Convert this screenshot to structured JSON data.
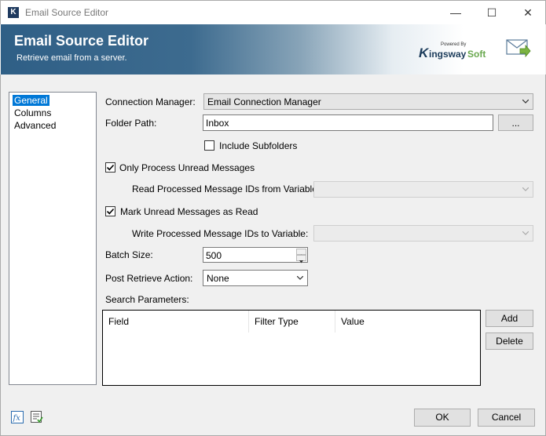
{
  "window": {
    "title": "Email Source Editor",
    "min_glyph": "—",
    "max_glyph": "☐",
    "close_glyph": "✕",
    "app_icon_letter": "K"
  },
  "banner": {
    "title": "Email Source Editor",
    "subtitle": "Retrieve email from a server.",
    "logo": {
      "powered": "Powered By",
      "k": "K",
      "ingsway": "ingsway",
      "soft": "Soft"
    }
  },
  "nav": {
    "items": [
      "General",
      "Columns",
      "Advanced"
    ],
    "selected": "General"
  },
  "form": {
    "connection_manager_label": "Connection Manager:",
    "connection_manager_value": "Email Connection Manager",
    "folder_path_label": "Folder Path:",
    "folder_path_value": "Inbox",
    "browse_label": "...",
    "include_subfolders_label": "Include Subfolders",
    "include_subfolders_checked": false,
    "only_unread_label": "Only Process Unread Messages",
    "only_unread_checked": true,
    "read_ids_var_label": "Read Processed Message IDs from Variable:",
    "read_ids_var_value": "",
    "mark_read_label": "Mark Unread Messages as Read",
    "mark_read_checked": true,
    "write_ids_var_label": "Write Processed Message IDs to Variable:",
    "write_ids_var_value": "",
    "batch_size_label": "Batch Size:",
    "batch_size_value": "500",
    "post_action_label": "Post Retrieve Action:",
    "post_action_value": "None",
    "search_params_label": "Search Parameters:"
  },
  "grid": {
    "columns": [
      "Field",
      "Filter Type",
      "Value"
    ],
    "rows": []
  },
  "buttons": {
    "add": "Add",
    "delete": "Delete",
    "ok": "OK",
    "cancel": "Cancel"
  },
  "colors": {
    "banner_dark": "#2f5f86",
    "selection": "#0078d7",
    "brand_green": "#6aa84f"
  }
}
